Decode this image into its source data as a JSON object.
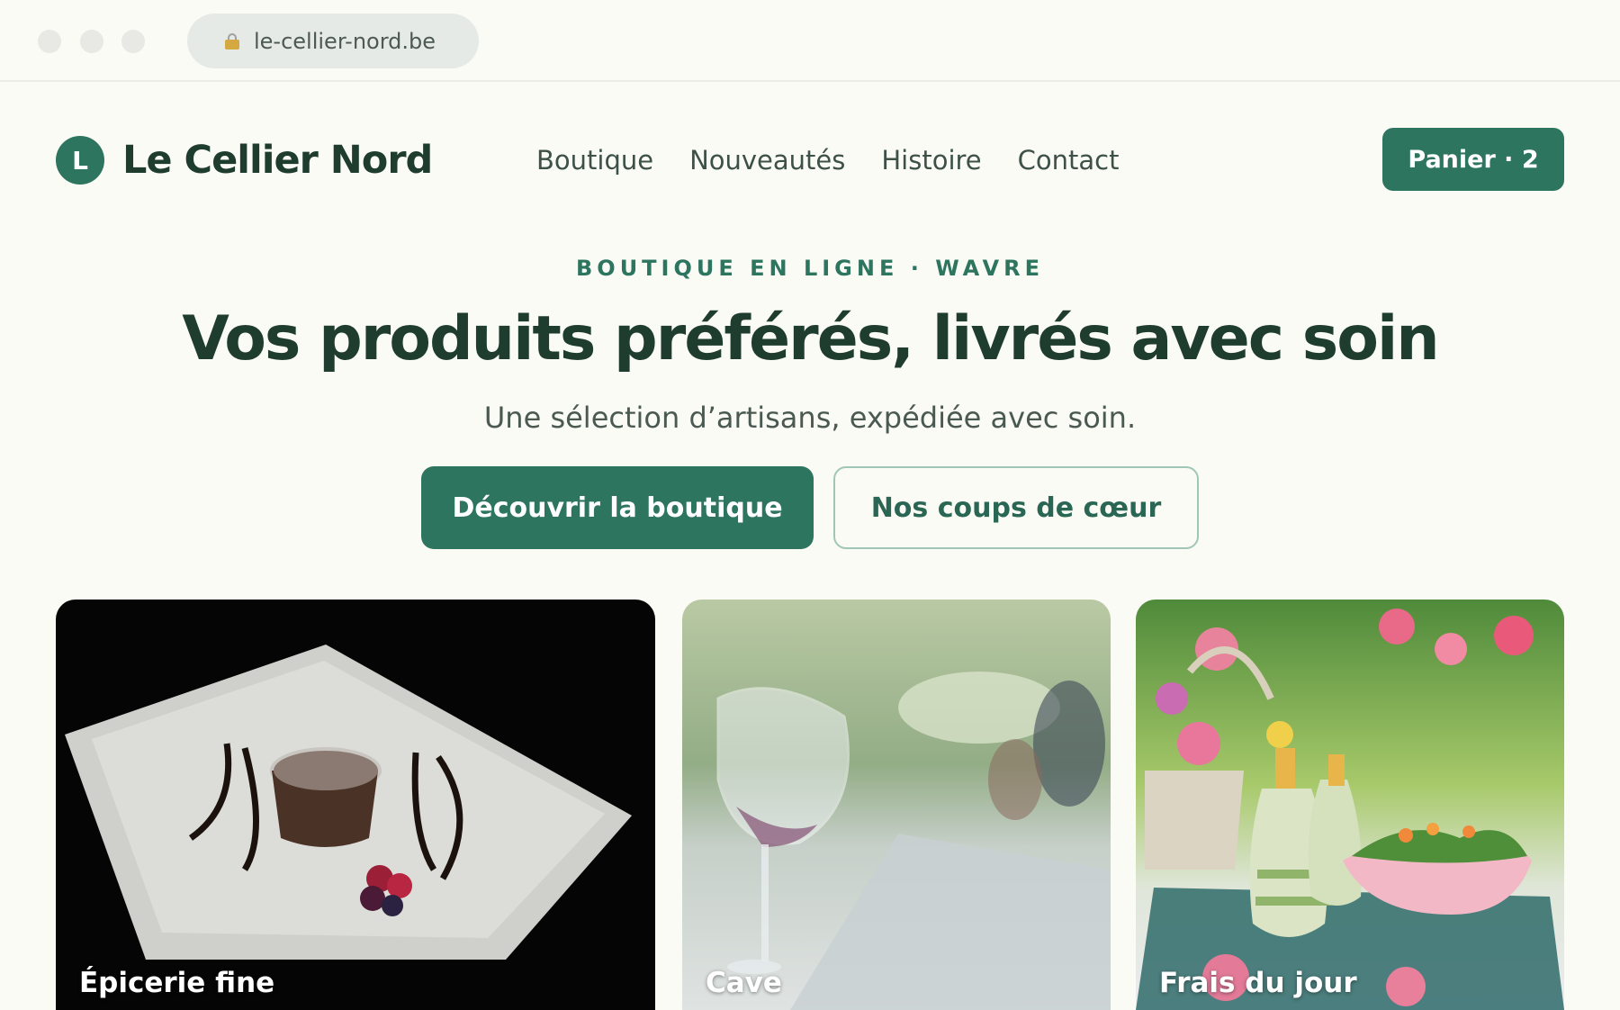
{
  "browser": {
    "url": "le-cellier-nord.be"
  },
  "header": {
    "logo_letter": "L",
    "brand": "Le Cellier Nord",
    "nav": [
      "Boutique",
      "Nouveautés",
      "Histoire",
      "Contact"
    ],
    "cart_label": "Panier · 2"
  },
  "hero": {
    "eyebrow": "BOUTIQUE EN LIGNE · WAVRE",
    "title": "Vos produits préférés, livrés avec soin",
    "subtitle": "Une sélection d’artisans, expédiée avec soin.",
    "primary_cta": "Découvrir la boutique",
    "secondary_cta": "Nos coups de cœur"
  },
  "categories": [
    {
      "label": "Épicerie fine",
      "image": "chocolate-lava-cake-photo"
    },
    {
      "label": "Cave",
      "image": "wine-glass-table-photo"
    },
    {
      "label": "Frais du jour",
      "image": "salad-flowers-table-photo"
    }
  ],
  "colors": {
    "accent": "#2e7560",
    "text_dark": "#1f3d2f",
    "background": "#fbfbf5"
  }
}
